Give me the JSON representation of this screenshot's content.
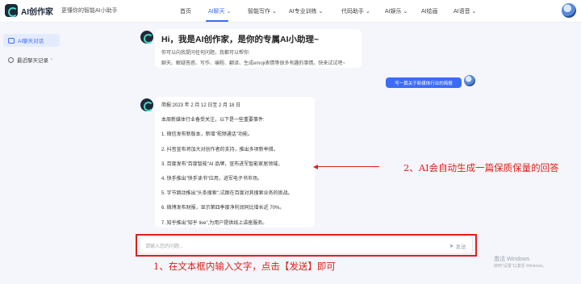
{
  "header": {
    "logo_text": "AI创作家",
    "slogan": "更懂你的智能AI小助手",
    "nav": [
      "首页",
      "AI聊天 ⌄",
      "智能写作 ⌄",
      "AI专业训练 ⌄",
      "代码助手 ⌄",
      "AI娱乐 ⌄",
      "AI绘画",
      "AI语音 ⌄"
    ],
    "active_nav_index": 1
  },
  "sidebar": {
    "items": [
      {
        "label": "AI聊天对话",
        "active": true,
        "icon": "chat-icon"
      },
      {
        "label": "最近聊天记录",
        "active": false,
        "icon": "clock-icon",
        "chevron": "›"
      }
    ]
  },
  "chat": {
    "greeting": {
      "title": "Hi，我是AI创作家，是你的专属AI小助理~",
      "subtitle": "你可以向我提问任何问题，我都可以帮你:",
      "tags": "聊天、解疑答惑、写作、编程、翻译、生成emoji表情等很多有趣的事情。快来试试吧~"
    },
    "user_message": "写一篇关于新媒体行业的简报",
    "answer_lines": [
      "简报:2023 年 2 月 12 日至 2 月 18 日",
      "本周新媒体行业备受关注，以下是一些重要事件:",
      "1. 微信发布新版本，新增\"视频通话\"功能。",
      "2. 抖音宣布将加大对创作者的支持，推出多项新举措。",
      "3. 百度发布\"百度智能\"AI 品牌，宣布进军智能家居领域。",
      "4. 快手推出\"快手读书\"应用，进军电子书市场。",
      "5. 字节跳动推出\"头条搜索\",试图在百度对其搜索业务的挑战。",
      "6. 微博发布财报，显示第四季度净利润同比增长近 70%。",
      "7. 知乎推出\"知乎 live\",为用户提供线上讲座服务。"
    ]
  },
  "composer": {
    "placeholder": "请输入您的问题...",
    "send_label": "发送"
  },
  "annotations": {
    "step1": "1、在文本框内输入文字，点击【发送】即可",
    "step2": "2、AI会自动生成一篇保质保量的回答"
  },
  "watermark": {
    "title": "激活 Windows",
    "subtitle": "转到\"设置\"以激活 Windows。"
  },
  "colors": {
    "accent": "#3b6cf6",
    "annotation_red": "#e0201a"
  }
}
